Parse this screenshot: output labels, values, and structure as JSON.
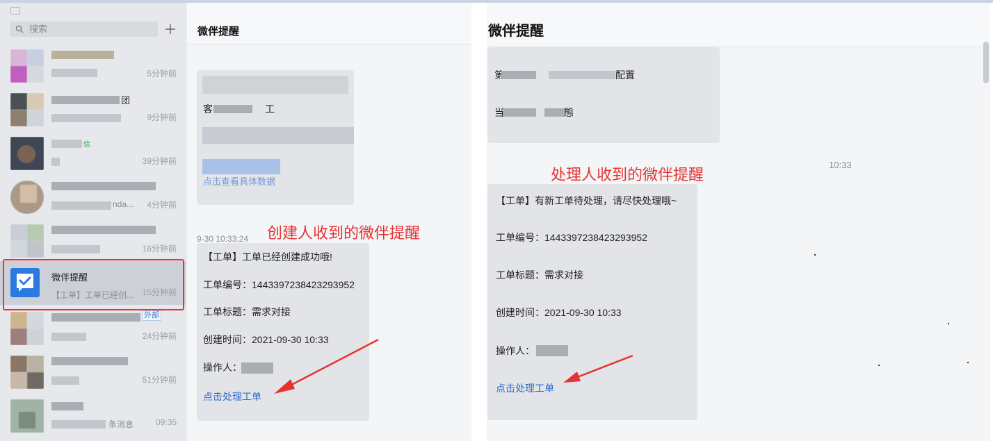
{
  "sidebar": {
    "search_placeholder": "搜索",
    "conversations": [
      {
        "time": "5分钟前"
      },
      {
        "time": "9分钟前",
        "title_tail": "团"
      },
      {
        "time": "39分钟前"
      },
      {
        "time": "4分钟前",
        "sub_text": "nda..."
      },
      {
        "time": "16分钟前"
      },
      {
        "name": "微伴提醒",
        "preview": "【工单】工单已经创...",
        "time": "15分钟前"
      },
      {
        "time": "24分钟前",
        "badge": "外部"
      },
      {
        "time": "51分钟前"
      },
      {
        "time": "09:35",
        "sub_text": "条消息"
      }
    ]
  },
  "middle": {
    "title": "微伴提醒",
    "timestamp": "9-30 10:33:24",
    "annotation": "创建人收到的微伴提醒",
    "card": {
      "line1": "【工单】工单已经创建成功哦!",
      "line2": "工单编号：1443397238423293952",
      "line3": "工单标题：需求对接",
      "line4": "创建时间：2021-09-30 10:33",
      "line5": "操作人：",
      "link": "点击处理工单"
    },
    "prev_card": {
      "fragment1": "客",
      "fragment2": "工",
      "link_fragment": "点击查看具体数据"
    }
  },
  "right": {
    "title": "微伴提醒",
    "timestamp": "10:33",
    "annotation": "处理人收到的微伴提醒",
    "prev_card": {
      "fragment1": "第",
      "fragment2": "配置",
      "fragment3": "当",
      "fragment4": "態"
    },
    "card": {
      "line1": "【工单】有新工单待处理，请尽快处理哦~",
      "line2": "工单编号：1443397238423293952",
      "line3": "工单标题：需求对接",
      "line4": "创建时间：2021-09-30 10:33",
      "line5": "操作人：",
      "link": "点击处理工单"
    }
  },
  "colors": {
    "accent_blue": "#2c6ccf",
    "annotation_red": "#e53333",
    "app_icon_blue": "#2a7ae2"
  }
}
